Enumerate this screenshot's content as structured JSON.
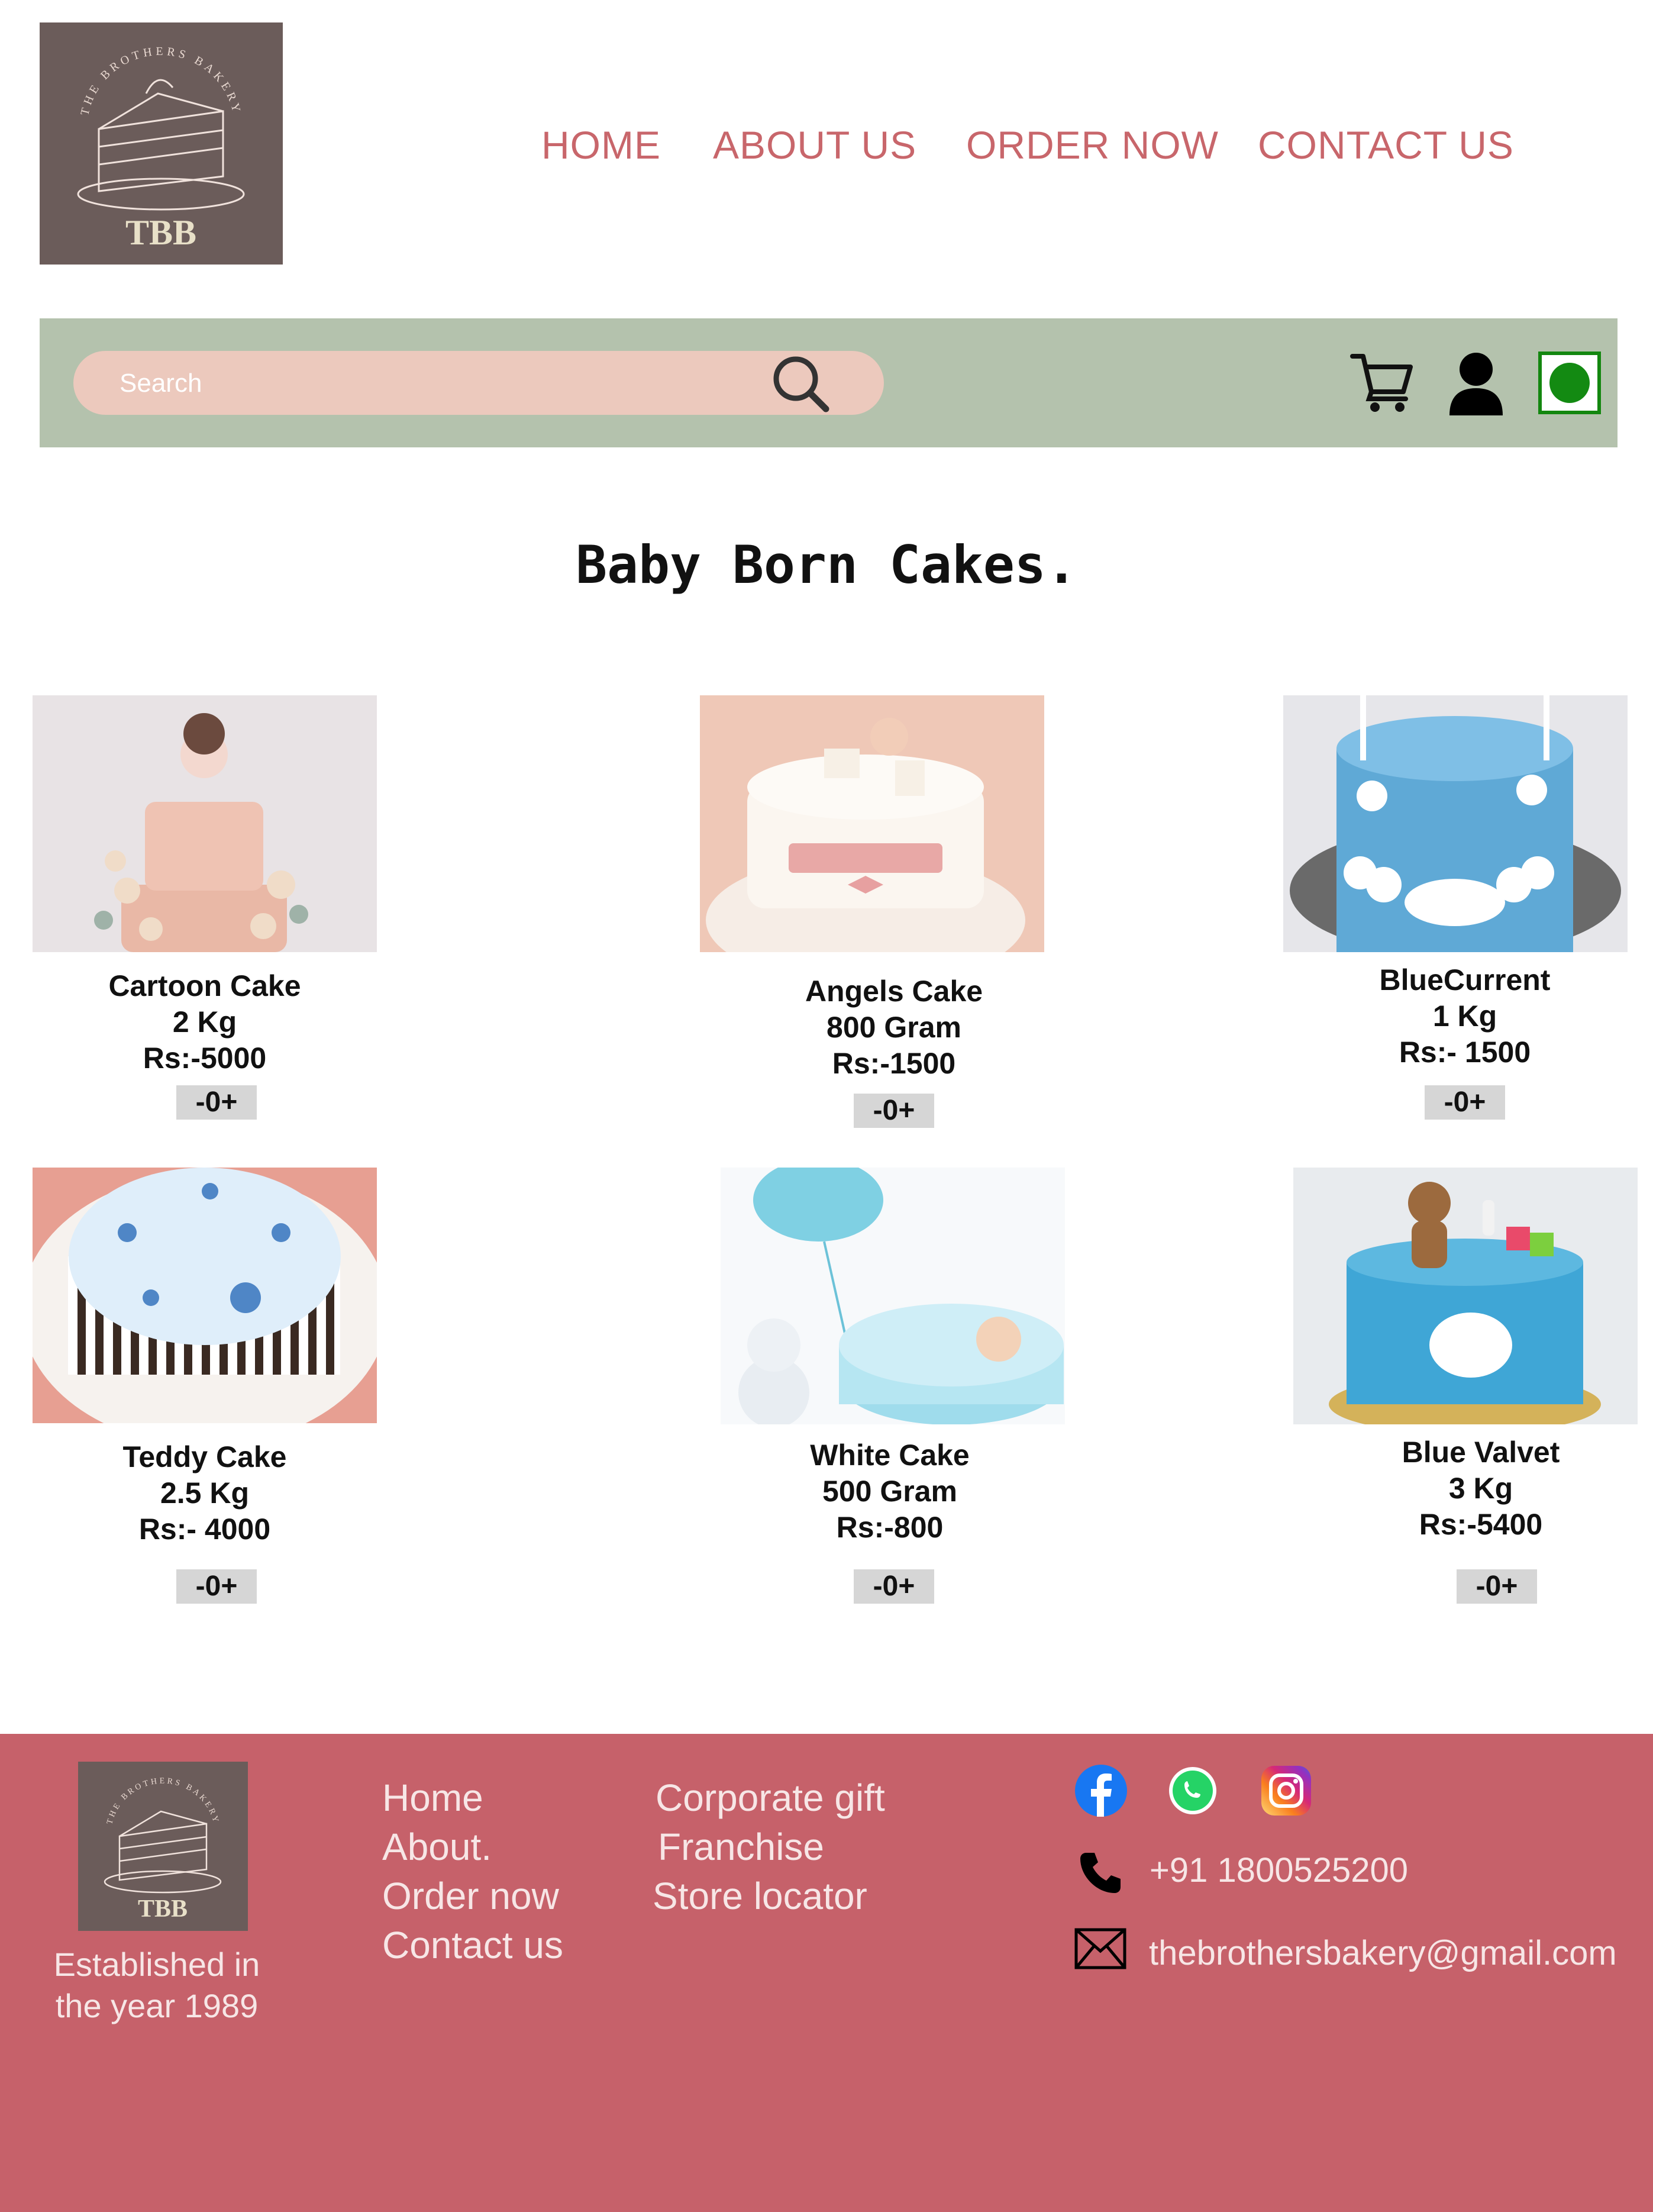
{
  "brand": {
    "logo_text": "TBB",
    "logo_arc_text": "THE BROTHERS BAKERY"
  },
  "nav": [
    {
      "label": "HOME"
    },
    {
      "label": "ABOUT US"
    },
    {
      "label": "ORDER NOW"
    },
    {
      "label": "CONTACT US"
    }
  ],
  "search": {
    "placeholder": "Search"
  },
  "toolbar_icons": [
    "search-icon",
    "cart-icon",
    "user-icon",
    "status-indicator"
  ],
  "page_title": "Baby Born Cakes.",
  "products": [
    {
      "name": "Cartoon Cake",
      "weight": "2 Kg",
      "price": "Rs:-5000",
      "qty": "-0+"
    },
    {
      "name": "Angels Cake",
      "weight": "800 Gram",
      "price": "Rs:-1500",
      "qty": "-0+"
    },
    {
      "name": "BlueCurrent",
      "weight": "1 Kg",
      "price": "Rs:- 1500",
      "qty": "-0+"
    },
    {
      "name": "Teddy Cake",
      "weight": "2.5 Kg",
      "price": "Rs:- 4000",
      "qty": "-0+"
    },
    {
      "name": "White Cake",
      "weight": "500 Gram",
      "price": "Rs:-800",
      "qty": "-0+"
    },
    {
      "name": "Blue Valvet",
      "weight": "3 Kg",
      "price": "Rs:-5400",
      "qty": "-0+"
    }
  ],
  "footer": {
    "established": [
      "Established in",
      "the year 1989"
    ],
    "links_col1": [
      "Home",
      "About.",
      "Order now",
      "Contact us"
    ],
    "links_col2": [
      "Corporate gift",
      "Franchise",
      "Store locator"
    ],
    "social": [
      "facebook-icon",
      "whatsapp-icon",
      "instagram-icon"
    ],
    "phone": "+91 1800525200",
    "email": "thebrothersbakery@gmail.com"
  },
  "colors": {
    "nav_text": "#c8666b",
    "toolbar_bg": "#b4c2ad",
    "search_bg": "#ecc9bd",
    "footer_bg": "#c6616a",
    "logo_bg": "#6b5c5a",
    "status_green": "#138a12"
  }
}
